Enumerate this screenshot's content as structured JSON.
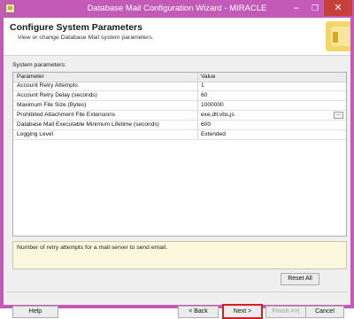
{
  "window": {
    "title": "Database Mail Configuration Wizard - MIRACLE",
    "controls": {
      "minimize": "–",
      "maximize": "❐",
      "close": "✕"
    }
  },
  "header": {
    "title": "Configure System Parameters",
    "subtitle": "View or change Database Mail system parameters."
  },
  "params": {
    "label": "System parameters:",
    "columns": {
      "parameter": "Parameter",
      "value": "Value"
    },
    "rows": [
      {
        "parameter": "Account Retry Attempts",
        "value": "1"
      },
      {
        "parameter": "Account Retry Delay (seconds)",
        "value": "60"
      },
      {
        "parameter": "Maximum File Size (Bytes)",
        "value": "1000000"
      },
      {
        "parameter": "Prohibited Attachment File Extensions",
        "value": "exe,dll,vbs,js"
      },
      {
        "parameter": "Database Mail Executable Minimum Lifetime (seconds)",
        "value": "600"
      },
      {
        "parameter": "Logging Level",
        "value": "Extended"
      }
    ],
    "ellipsis": "..."
  },
  "description": "Number of retry attempts for a mail server to send email.",
  "buttons": {
    "reset": "Reset All",
    "help": "Help",
    "back": "< Back",
    "next": "Next >",
    "finish": "Finish >>|",
    "cancel": "Cancel"
  },
  "colors": {
    "titlebar": "#c35ab8",
    "close": "#c7403a",
    "highlight": "#d42020",
    "description_bg": "#fbf8dd"
  }
}
